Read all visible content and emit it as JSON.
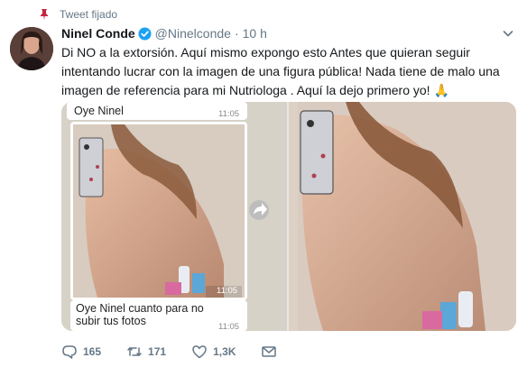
{
  "pinned": {
    "label": "Tweet fijado",
    "icon": "pin-icon"
  },
  "author": {
    "name": "Ninel Conde",
    "handle": "@Ninelconde",
    "separator": "·",
    "time": "10 h",
    "verified_icon": "verified-icon",
    "verified_color": "#1da1f2"
  },
  "tweet": {
    "text": "Di NO a la extorsión. Aquí mismo expongo esto Antes que quieran seguir intentando lucrar con la imagen de una figura pública! Nada tiene de malo una imagen de referencia para mi Nutriologa . Aquí la dejo primero yo! 🙏"
  },
  "chat": {
    "message_top": "Oye Ninel",
    "time_top": "11:05",
    "image_time": "11:05",
    "message_bottom": "Oye Ninel cuanto para no subir tus fotos",
    "time_bottom": "11:05",
    "forward_icon": "forward-icon"
  },
  "actions": {
    "reply": {
      "icon": "reply-icon",
      "count": "165"
    },
    "retweet": {
      "icon": "retweet-icon",
      "count": "171"
    },
    "like": {
      "icon": "heart-icon",
      "count": "1,3K"
    },
    "message": {
      "icon": "envelope-icon"
    }
  },
  "colors": {
    "secondary_text": "#657786",
    "accent": "#1da1f2",
    "pin": "#e0245e"
  }
}
